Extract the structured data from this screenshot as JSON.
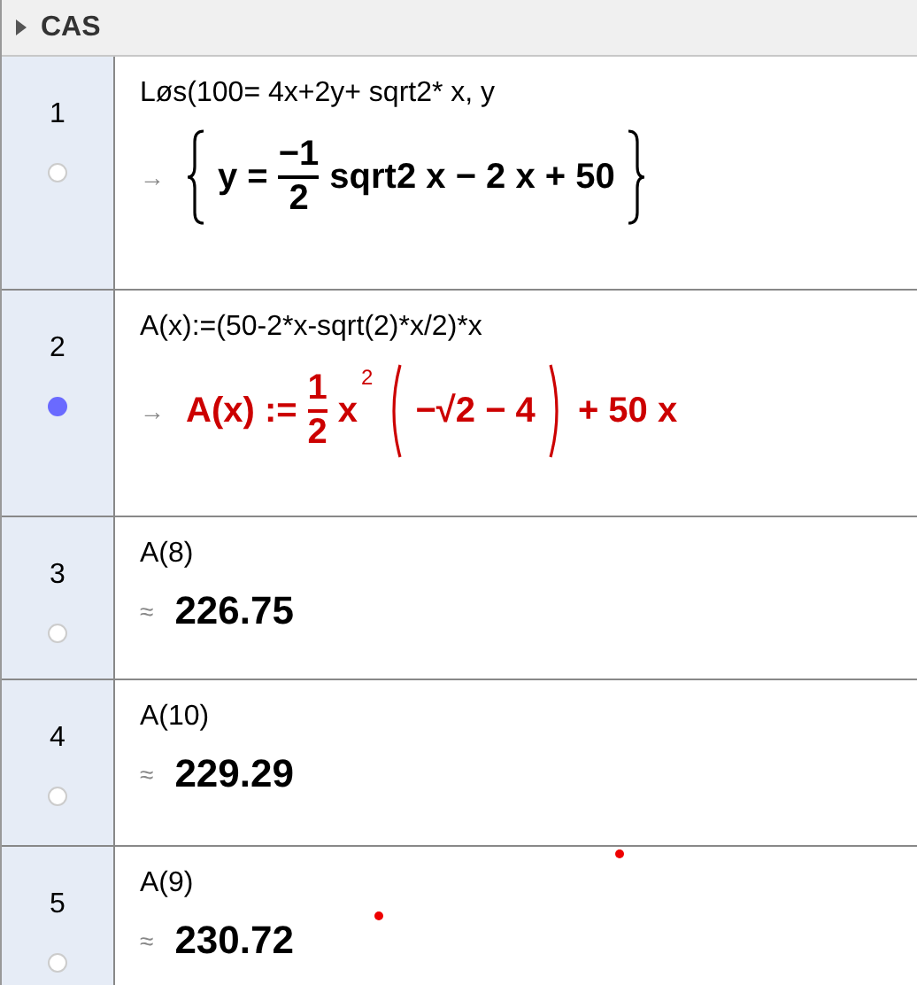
{
  "panel": {
    "title": "CAS"
  },
  "rows": [
    {
      "number": "1",
      "visible": false,
      "input": "Løs(100= 4x+2y+ sqrt2* x, y",
      "output": {
        "symbol": "→",
        "color": "#000000",
        "parts": [
          {
            "kind": "braces",
            "parts": [
              {
                "kind": "text",
                "text": "y ="
              },
              {
                "kind": "frac",
                "num": "−1",
                "den": "2"
              },
              {
                "kind": "text",
                "text": "sqrt2 x − 2 x + 50"
              }
            ]
          }
        ]
      }
    },
    {
      "number": "2",
      "visible": true,
      "input": "A(x):=(50-2*x-sqrt(2)*x/2)*x",
      "output": {
        "symbol": "→",
        "color": "#cc0000",
        "parts": [
          {
            "kind": "text",
            "text": "A(x) :="
          },
          {
            "kind": "frac",
            "num": "1",
            "den": "2"
          },
          {
            "kind": "text",
            "text": "x"
          },
          {
            "kind": "sup",
            "text": "2"
          },
          {
            "kind": "parens",
            "parts": [
              {
                "kind": "text",
                "text": "−√2 − 4"
              }
            ]
          },
          {
            "kind": "text",
            "text": "+ 50 x"
          }
        ]
      }
    },
    {
      "number": "3",
      "visible": false,
      "input": "A(8)",
      "output": {
        "symbol": "≈",
        "color": "#000000",
        "parts": [
          {
            "kind": "text",
            "text": "226.75"
          }
        ]
      }
    },
    {
      "number": "4",
      "visible": false,
      "input": "A(10)",
      "output": {
        "symbol": "≈",
        "color": "#000000",
        "parts": [
          {
            "kind": "text",
            "text": "229.29"
          }
        ]
      }
    },
    {
      "number": "5",
      "visible": false,
      "input": "A(9)",
      "output": {
        "symbol": "≈",
        "color": "#000000",
        "parts": [
          {
            "kind": "text",
            "text": "230.72"
          }
        ]
      }
    }
  ]
}
